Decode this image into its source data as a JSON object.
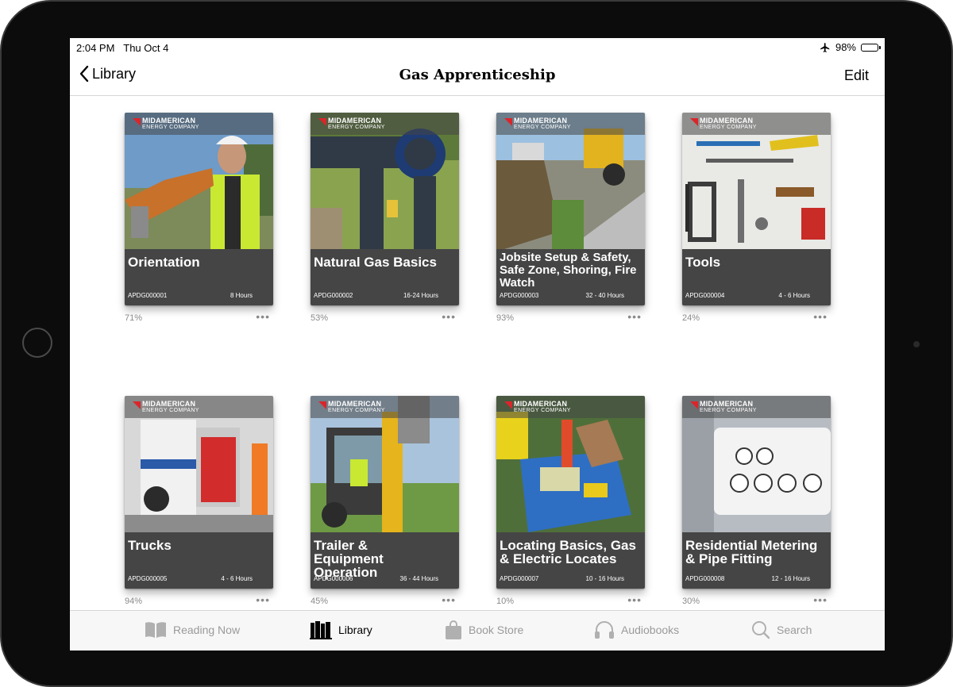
{
  "status_bar": {
    "time": "2:04 PM",
    "date": "Thu Oct 4",
    "battery": "98%",
    "battery_level": 0.98
  },
  "nav": {
    "back_label": "Library",
    "title": "Gas Apprenticeship",
    "edit_label": "Edit"
  },
  "brand": {
    "name": "MIDAMERICAN",
    "sub": "ENERGY COMPANY",
    "accent": "#d9262b"
  },
  "books": [
    {
      "title": "Orientation",
      "code": "APDG000001",
      "hours": "8 Hours",
      "progress": "71%",
      "more": "•••"
    },
    {
      "title": "Natural Gas Basics",
      "code": "APDG000002",
      "hours": "16-24 Hours",
      "progress": "53%",
      "more": "•••"
    },
    {
      "title": "Jobsite Setup & Safety, Safe Zone, Shoring, Fire Watch",
      "code": "APDG000003",
      "hours": "32 - 40 Hours",
      "progress": "93%",
      "more": "•••"
    },
    {
      "title": "Tools",
      "code": "APDG000004",
      "hours": "4 - 6 Hours",
      "progress": "24%",
      "more": "•••"
    },
    {
      "title": "Trucks",
      "code": "APDG000005",
      "hours": "4 - 6 Hours",
      "progress": "94%",
      "more": "•••"
    },
    {
      "title": "Trailer & Equipment Operation",
      "code": "APDG000006",
      "hours": "36 - 44 Hours",
      "progress": "45%",
      "more": "•••"
    },
    {
      "title": "Locating Basics, Gas & Electric Locates",
      "code": "APDG000007",
      "hours": "10 - 16 Hours",
      "progress": "10%",
      "more": "•••"
    },
    {
      "title": "Residential Metering & Pipe Fitting",
      "code": "APDG000008",
      "hours": "12 - 16 Hours",
      "progress": "30%",
      "more": "•••"
    }
  ],
  "tabs": [
    {
      "label": "Reading Now",
      "icon": "book-open-icon",
      "active": false
    },
    {
      "label": "Library",
      "icon": "books-icon",
      "active": true
    },
    {
      "label": "Book Store",
      "icon": "shopping-bag-icon",
      "active": false
    },
    {
      "label": "Audiobooks",
      "icon": "headphones-icon",
      "active": false
    },
    {
      "label": "Search",
      "icon": "search-icon",
      "active": false
    }
  ]
}
